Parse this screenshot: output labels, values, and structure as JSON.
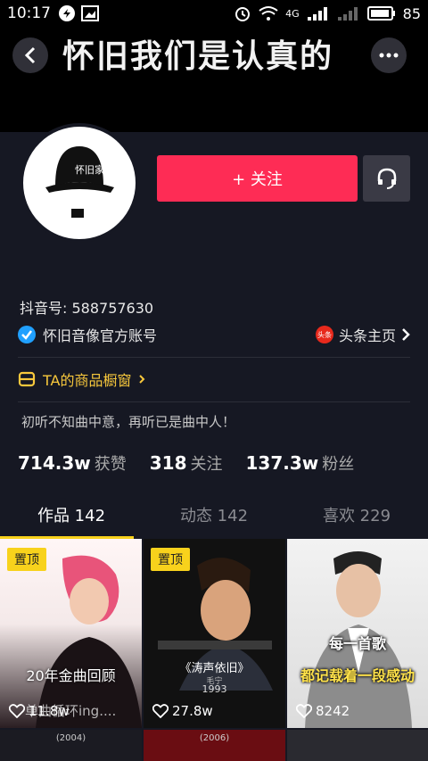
{
  "status": {
    "time": "10:17",
    "battery": "85",
    "network": "4G"
  },
  "header": {
    "title": "怀旧我们是认真的",
    "hat_text": "怀旧家"
  },
  "profile": {
    "follow_label": "+ 关注",
    "douyin_id": "抖音号: 588757630",
    "verified_label": "怀旧音像官方账号",
    "toutiao_badge": "头条",
    "toutiao_link": "头条主页",
    "shop_label": "TA的商品橱窗",
    "bio": "初听不知曲中意，再听已是曲中人！"
  },
  "stats": [
    {
      "value": "714.3w",
      "label": "获赞"
    },
    {
      "value": "318",
      "label": "关注"
    },
    {
      "value": "137.3w",
      "label": "粉丝"
    }
  ],
  "tabs": [
    {
      "label": "作品 142",
      "active": true
    },
    {
      "label": "动态 142",
      "active": false
    },
    {
      "label": "喜欢 229",
      "active": false
    }
  ],
  "videos": [
    {
      "pinned": "置顶",
      "caption": "20年金曲回顾",
      "overlay": "单曲循环ing....",
      "likes": "11.8w"
    },
    {
      "pinned": "置顶",
      "caption": "《涛声依旧》",
      "year": "1993",
      "singer": "毛宁",
      "likes": "27.8w"
    },
    {
      "caption1": "每一首歌",
      "caption2": "都记载着一段感动",
      "likes": "8242"
    }
  ],
  "bottom_row": [
    {
      "label": "(2004)"
    },
    {
      "label": "(2006)"
    }
  ],
  "colors": {
    "accent": "#fe2c55",
    "bg": "#161823",
    "pin": "#f8d21c",
    "shop": "#f8c83c",
    "verified": "#20a0ff"
  }
}
